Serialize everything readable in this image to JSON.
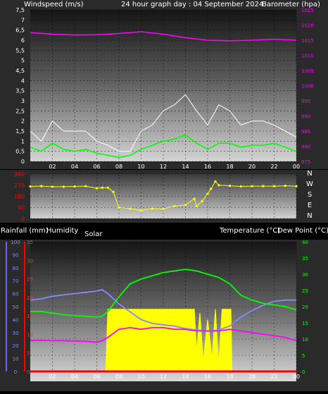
{
  "chart_data": [
    {
      "type": "line",
      "title": "24 hour graph day : 04 September 2024",
      "ylabel_left": "Windspeed (m/s)",
      "ylabel_right": "Barometer (hpa)",
      "x_ticks": [
        "02",
        "04",
        "06",
        "08",
        "10",
        "12",
        "14",
        "16",
        "18",
        "20",
        "22",
        "00"
      ],
      "y_left_ticks": [
        "0",
        "0,5",
        "1",
        "1,5",
        "2",
        "2,5",
        "3",
        "3,5",
        "4",
        "4,5",
        "5",
        "5,5",
        "6",
        "6,5",
        "7",
        "7,5"
      ],
      "y_right_ticks": [
        "975",
        "980",
        "985",
        "990",
        "995",
        "1000",
        "1005",
        "1010",
        "1015",
        "1020",
        "1025"
      ],
      "ylim_left": [
        0,
        7.5
      ],
      "ylim_right": [
        975,
        1025
      ],
      "series": [
        {
          "key": "gust",
          "color": "#ffffff",
          "axis": "left",
          "x": [
            0,
            1,
            2,
            3,
            4,
            5,
            6,
            7,
            8,
            9,
            10,
            11,
            12,
            13,
            14,
            15,
            16,
            17,
            18,
            19,
            20,
            21,
            22,
            23,
            24
          ],
          "values": [
            1.5,
            1.0,
            2.0,
            1.5,
            1.5,
            1.5,
            1.0,
            0.8,
            0.5,
            0.5,
            1.5,
            1.8,
            2.5,
            2.8,
            3.3,
            2.5,
            1.8,
            2.8,
            2.5,
            1.8,
            2.0,
            2.0,
            1.8,
            1.5,
            1.2
          ]
        },
        {
          "key": "wind",
          "color": "#00ff00",
          "axis": "left",
          "x": [
            0,
            1,
            2,
            3,
            4,
            5,
            6,
            7,
            8,
            9,
            10,
            11,
            12,
            13,
            14,
            15,
            16,
            17,
            18,
            19,
            20,
            21,
            22,
            23,
            24
          ],
          "values": [
            0.7,
            0.5,
            0.9,
            0.6,
            0.5,
            0.6,
            0.4,
            0.3,
            0.2,
            0.3,
            0.6,
            0.8,
            1.0,
            1.1,
            1.3,
            0.9,
            0.6,
            0.9,
            0.9,
            0.7,
            0.8,
            0.8,
            0.9,
            0.7,
            0.5
          ]
        },
        {
          "key": "pressure",
          "color": "#ff00ff",
          "axis": "right",
          "x": [
            0,
            2,
            4,
            6,
            8,
            10,
            12,
            14,
            16,
            18,
            20,
            22,
            24
          ],
          "values": [
            1017.5,
            1017.0,
            1016.7,
            1016.8,
            1017.2,
            1017.8,
            1017.0,
            1015.8,
            1015.0,
            1014.8,
            1015.0,
            1015.3,
            1015.0
          ]
        }
      ]
    },
    {
      "type": "scatter",
      "y_ticks": [
        "0",
        "90",
        "180",
        "270",
        "360"
      ],
      "ylim": [
        0,
        360
      ],
      "right_labels": [
        "N",
        "W",
        "S",
        "E",
        "N"
      ],
      "series": [
        {
          "key": "direction",
          "color": "#ffff00",
          "x": [
            0,
            1,
            2,
            3,
            4,
            5,
            6,
            6.5,
            7,
            7.5,
            8,
            9,
            10,
            11,
            12,
            13,
            14,
            14.8,
            15,
            15.5,
            16,
            16.3,
            16.7,
            17,
            18,
            19,
            20,
            21,
            22,
            23,
            24
          ],
          "values": [
            260,
            262,
            258,
            258,
            260,
            262,
            245,
            250,
            250,
            215,
            90,
            80,
            65,
            80,
            78,
            100,
            110,
            160,
            100,
            140,
            200,
            240,
            300,
            270,
            265,
            260,
            262,
            262,
            262,
            265,
            262
          ]
        }
      ]
    },
    {
      "type": "line",
      "labels": [
        "Rainfall (mm)",
        "Humidity",
        "Solar",
        "Temperature (°C)",
        "Dew Point (°C)"
      ],
      "x_ticks": [
        "02",
        "04",
        "06",
        "08",
        "10",
        "12",
        "14",
        "16",
        "18",
        "20",
        "22",
        "00"
      ],
      "humidity_ticks": [
        "0",
        "10",
        "20",
        "30",
        "40",
        "50",
        "60",
        "70",
        "80",
        "90",
        "100"
      ],
      "rain_ticks": [
        "0",
        "5",
        "10",
        "15",
        "20",
        "25",
        "30",
        "35"
      ],
      "temp_ticks": [
        "0",
        "5",
        "10",
        "15",
        "20",
        "25",
        "30",
        "35",
        "40"
      ],
      "humidity_range": [
        0,
        100
      ],
      "rain_range": [
        0,
        35
      ],
      "temp_range": [
        0,
        40
      ],
      "solar_range": [
        0,
        100
      ],
      "series": [
        {
          "key": "humidity",
          "color": "#8888ff",
          "axis": "humidity",
          "x": [
            0,
            1,
            2,
            3,
            4,
            5,
            6,
            6.5,
            7,
            8,
            9,
            10,
            11,
            12,
            13,
            14,
            15,
            16,
            17,
            18,
            19,
            20,
            21,
            22,
            23,
            24
          ],
          "values": [
            55,
            56,
            58,
            59,
            60,
            61,
            62,
            63,
            60,
            52,
            46,
            40,
            37,
            36,
            35,
            33,
            32,
            31,
            32,
            35,
            42,
            47,
            51,
            54,
            55,
            55
          ]
        },
        {
          "key": "temperature",
          "color": "#00ff00",
          "axis": "temp",
          "x": [
            0,
            1,
            2,
            3,
            4,
            5,
            6,
            6.5,
            7,
            8,
            9,
            10,
            11,
            12,
            13,
            14,
            15,
            16,
            17,
            18,
            19,
            20,
            21,
            22,
            23,
            24
          ],
          "values": [
            18.5,
            18.5,
            18.0,
            17.5,
            17.2,
            17.0,
            16.8,
            17.0,
            18.5,
            23,
            27,
            28.5,
            29.5,
            30.5,
            31.0,
            31.5,
            31.0,
            30.0,
            29.0,
            27,
            23.5,
            22.0,
            21.0,
            20.5,
            20.0,
            19.0
          ]
        },
        {
          "key": "dewpoint",
          "color": "#ff00ff",
          "axis": "temp",
          "x": [
            0,
            1,
            2,
            3,
            4,
            5,
            6,
            6.5,
            7,
            8,
            9,
            10,
            11,
            12,
            13,
            14,
            15,
            16,
            17,
            18,
            19,
            20,
            21,
            22,
            23,
            24
          ],
          "values": [
            9.5,
            9.6,
            9.5,
            9.5,
            9.4,
            9.3,
            9.0,
            9.5,
            10.5,
            13.0,
            13.5,
            13.0,
            13.5,
            13.5,
            13.0,
            13.0,
            12.5,
            12.5,
            12.5,
            13.0,
            12.5,
            12.0,
            11.5,
            11.0,
            10.5,
            9.5
          ]
        },
        {
          "key": "solar",
          "color": "#ffff00",
          "axis": "solar",
          "x": [
            6.8,
            7.0,
            7.3,
            8,
            9,
            10,
            11,
            12,
            13,
            13.5,
            13.8,
            14.2,
            14.8,
            15.0,
            15.3,
            15.6,
            16,
            16.4,
            16.7,
            17.0,
            17.3,
            17.8,
            18.1,
            18.2
          ],
          "values": [
            0,
            48,
            48,
            48,
            48,
            48,
            48,
            48,
            48,
            48,
            48,
            48,
            48,
            15,
            45,
            8,
            40,
            10,
            48,
            6,
            48,
            48,
            48,
            0
          ]
        },
        {
          "key": "rain",
          "color": "#ff0000",
          "axis": "rain",
          "x": [
            0,
            24
          ],
          "values": [
            0,
            0
          ]
        }
      ]
    }
  ]
}
